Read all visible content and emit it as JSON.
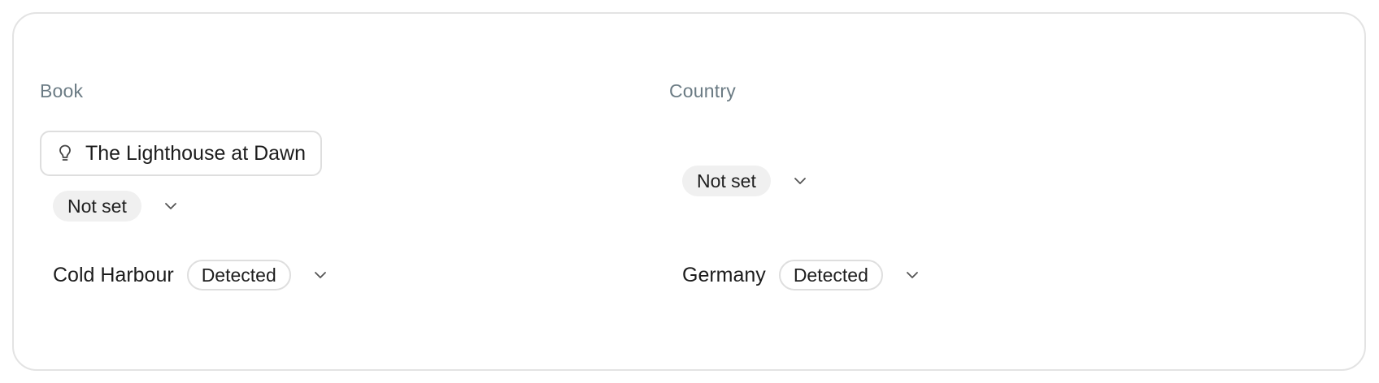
{
  "book": {
    "label": "Book",
    "title": "The Lighthouse at Dawn",
    "icon": "lightbulb-icon",
    "status": "Not set",
    "detected_value": "Cold Harbour",
    "detected_badge": "Detected"
  },
  "country": {
    "label": "Country",
    "status": "Not set",
    "detected_value": "Germany",
    "detected_badge": "Detected"
  },
  "colors": {
    "label": "#6b7b84",
    "pill_bg": "#f0f0f0",
    "border": "#dedede"
  }
}
